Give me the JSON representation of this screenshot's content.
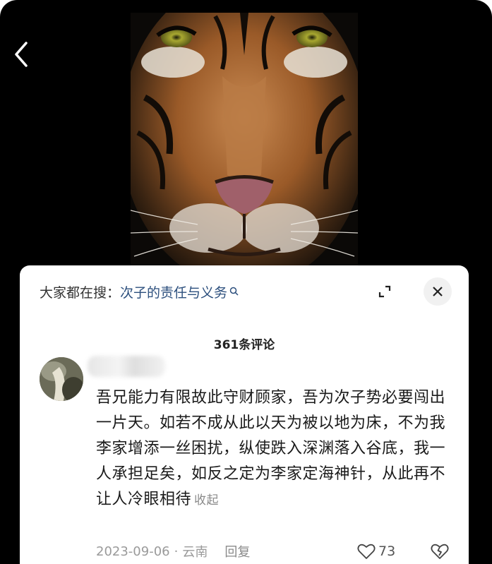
{
  "search": {
    "prefix": "大家都在搜：",
    "query": "次子的责任与义务"
  },
  "comments": {
    "count_label": "361条评论"
  },
  "comment": {
    "text": "吾兄能力有限故此守财顾家，吾为次子势必要闯出一片天。如若不成从此以天为被以地为床，不为我李家增添一丝困扰，纵使跌入深渊落入谷底，我一人承担足矣，如反之定为李家定海神针，从此再不让人冷眼相待",
    "collapse_label": "收起",
    "date": "2023-09-06",
    "dot": "·",
    "location": "云南",
    "reply_label": "回复",
    "like_count": "73"
  },
  "icons": {
    "back": "chevron-left-icon",
    "search": "search-icon",
    "expand": "expand-icon",
    "close": "close-icon",
    "like": "heart-icon",
    "dislike": "broken-heart-icon"
  },
  "colors": {
    "background": "#000000",
    "sheet": "#ffffff",
    "link": "#2c4f7d",
    "meta": "#9a9a9a"
  }
}
